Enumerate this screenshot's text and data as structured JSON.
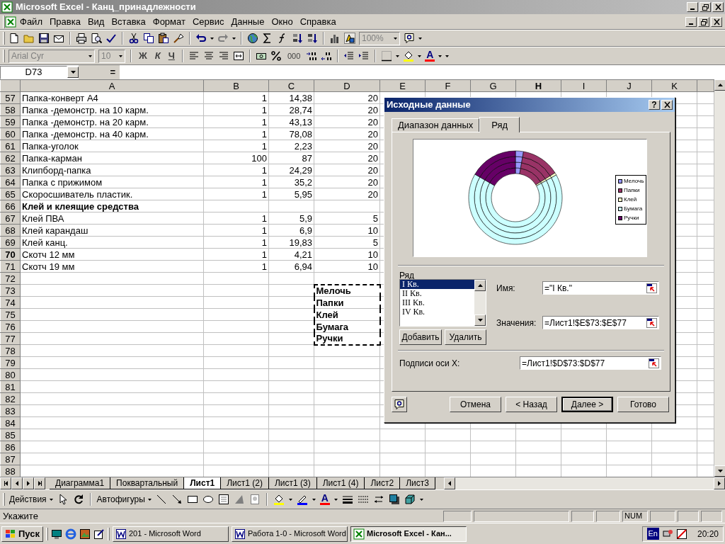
{
  "window": {
    "title": "Microsoft Excel - Канц_принадлежности"
  },
  "menu": [
    "Файл",
    "Правка",
    "Вид",
    "Вставка",
    "Формат",
    "Сервис",
    "Данные",
    "Окно",
    "Справка"
  ],
  "standard_toolbar": {
    "zoom": {
      "value": "100%",
      "disabled": true
    }
  },
  "formatting_toolbar": {
    "font": {
      "value": "Arial Cyr",
      "disabled": true
    },
    "size": {
      "value": "10",
      "disabled": true
    },
    "style_buttons": [
      "Ж",
      "К",
      "Ч"
    ],
    "thousands": "000",
    "font_color_glyph": "A"
  },
  "formula_bar": {
    "cell": "D73",
    "equals": "="
  },
  "sheet": {
    "columns": [
      {
        "label": "A",
        "selected": false
      },
      {
        "label": "B",
        "selected": false
      },
      {
        "label": "C",
        "selected": false
      },
      {
        "label": "D",
        "selected": false
      },
      {
        "label": "E",
        "selected": false
      },
      {
        "label": "F",
        "selected": false
      },
      {
        "label": "G",
        "selected": false
      },
      {
        "label": "H",
        "selected": true
      },
      {
        "label": "I",
        "selected": false
      },
      {
        "label": "J",
        "selected": false
      },
      {
        "label": "K",
        "selected": false
      }
    ],
    "rows": [
      {
        "header": "57",
        "selected": false,
        "bold": false,
        "marquee": false,
        "cells": {
          "A": "Папка-конверт А4",
          "B": "1",
          "C": "14,38",
          "D": "20"
        }
      },
      {
        "header": "58",
        "selected": false,
        "bold": false,
        "marquee": false,
        "cells": {
          "A": "Папка -демонстр. на 10 карм.",
          "B": "1",
          "C": "28,74",
          "D": "20"
        }
      },
      {
        "header": "59",
        "selected": false,
        "bold": false,
        "marquee": false,
        "cells": {
          "A": "Папка -демонстр. на 20 карм.",
          "B": "1",
          "C": "43,13",
          "D": "20"
        }
      },
      {
        "header": "60",
        "selected": false,
        "bold": false,
        "marquee": false,
        "cells": {
          "A": "Папка -демонстр. на 40 карм.",
          "B": "1",
          "C": "78,08",
          "D": "20"
        }
      },
      {
        "header": "61",
        "selected": false,
        "bold": false,
        "marquee": false,
        "cells": {
          "A": "Папка-уголок",
          "B": "1",
          "C": "2,23",
          "D": "20"
        }
      },
      {
        "header": "62",
        "selected": false,
        "bold": false,
        "marquee": false,
        "cells": {
          "A": "Папка-карман",
          "B": "100",
          "C": "87",
          "D": "20"
        }
      },
      {
        "header": "63",
        "selected": false,
        "bold": false,
        "marquee": false,
        "cells": {
          "A": "Клипборд-папка",
          "B": "1",
          "C": "24,29",
          "D": "20"
        }
      },
      {
        "header": "64",
        "selected": false,
        "bold": false,
        "marquee": false,
        "cells": {
          "A": "Папка с прижимом",
          "B": "1",
          "C": "35,2",
          "D": "20"
        }
      },
      {
        "header": "65",
        "selected": false,
        "bold": false,
        "marquee": false,
        "cells": {
          "A": "Скоросшиватель пластик.",
          "B": "1",
          "C": "5,95",
          "D": "20"
        }
      },
      {
        "header": "66",
        "selected": false,
        "bold": true,
        "marquee": false,
        "cells": {
          "A": "Клей и клеящие средства"
        }
      },
      {
        "header": "67",
        "selected": false,
        "bold": false,
        "marquee": false,
        "cells": {
          "A": "Клей ПВА",
          "B": "1",
          "C": "5,9",
          "D": "5"
        }
      },
      {
        "header": "68",
        "selected": false,
        "bold": false,
        "marquee": false,
        "cells": {
          "A": "Клей карандаш",
          "B": "1",
          "C": "6,9",
          "D": "10"
        }
      },
      {
        "header": "69",
        "selected": false,
        "bold": false,
        "marquee": false,
        "cells": {
          "A": "Клей канц.",
          "B": "1",
          "C": "19,83",
          "D": "5"
        }
      },
      {
        "header": "70",
        "selected": true,
        "bold": false,
        "marquee": false,
        "cells": {
          "A": "Скотч 12 мм",
          "B": "1",
          "C": "4,21",
          "D": "10"
        }
      },
      {
        "header": "71",
        "selected": false,
        "bold": false,
        "marquee": false,
        "cells": {
          "A": "Скотч 19 мм",
          "B": "1",
          "C": "6,94",
          "D": "10"
        }
      },
      {
        "header": "72",
        "selected": false
      },
      {
        "header": "73",
        "selected": false,
        "bold": true,
        "marquee": true,
        "cells": {
          "D": "Мелочь"
        }
      },
      {
        "header": "74",
        "selected": false,
        "bold": true,
        "marquee": true,
        "cells": {
          "D": "Папки"
        }
      },
      {
        "header": "75",
        "selected": false,
        "bold": true,
        "marquee": true,
        "cells": {
          "D": "Клей"
        }
      },
      {
        "header": "76",
        "selected": false,
        "bold": true,
        "marquee": true,
        "cells": {
          "D": "Бумага"
        }
      },
      {
        "header": "77",
        "selected": false,
        "bold": true,
        "marquee": true,
        "cells": {
          "D": "Ручки"
        }
      },
      {
        "header": "78",
        "selected": false
      },
      {
        "header": "79",
        "selected": false
      },
      {
        "header": "80",
        "selected": false
      },
      {
        "header": "81",
        "selected": false
      },
      {
        "header": "82",
        "selected": false
      },
      {
        "header": "83",
        "selected": false
      },
      {
        "header": "84",
        "selected": false
      },
      {
        "header": "85",
        "selected": false
      },
      {
        "header": "86",
        "selected": false
      },
      {
        "header": "87",
        "selected": false
      },
      {
        "header": "88",
        "selected": false
      }
    ]
  },
  "dialog": {
    "title": "Исходные данные",
    "help": "?",
    "tabs": [
      {
        "label": "Диапазон данных",
        "selected": false
      },
      {
        "label": "Ряд",
        "selected": true
      }
    ],
    "legend": [
      {
        "label": "Мелочь",
        "color": "#9999ff"
      },
      {
        "label": "Папки",
        "color": "#993366"
      },
      {
        "label": "Клей",
        "color": "#ffffcc"
      },
      {
        "label": "Бумага",
        "color": "#ccffff"
      },
      {
        "label": "Ручки",
        "color": "#660066"
      }
    ],
    "series_label": "Ряд",
    "series": [
      {
        "label": "I Кв.",
        "selected": true
      },
      {
        "label": "II Кв.",
        "selected": false
      },
      {
        "label": "III Кв.",
        "selected": false
      },
      {
        "label": "IV Кв.",
        "selected": false
      }
    ],
    "add": "Добавить",
    "remove": "Удалить",
    "fields": [
      {
        "label": "Имя:",
        "value": "=\"I Кв.\""
      },
      {
        "label": "Значения:",
        "value": "=Лист1!$E$73:$E$77"
      }
    ],
    "x_labels": {
      "label": "Подписи оси X:",
      "value": "=Лист1!$D$73:$D$77"
    },
    "buttons": [
      {
        "label": "Отмена",
        "default": false
      },
      {
        "label": "< Назад",
        "default": false
      },
      {
        "label": "Далее >",
        "default": true
      },
      {
        "label": "Готово",
        "default": false
      }
    ]
  },
  "sheet_tabs": [
    {
      "label": "Диаграмма1",
      "selected": false
    },
    {
      "label": "Поквартальный",
      "selected": false
    },
    {
      "label": "Лист1",
      "selected": true
    },
    {
      "label": "Лист1 (2)",
      "selected": false
    },
    {
      "label": "Лист1 (3)",
      "selected": false
    },
    {
      "label": "Лист1 (4)",
      "selected": false
    },
    {
      "label": "Лист2",
      "selected": false
    },
    {
      "label": "Лист3",
      "selected": false
    }
  ],
  "drawing_toolbar": {
    "actions": "Действия",
    "autoshapes": "Автофигуры",
    "font_color_glyph": "A"
  },
  "status_bar": {
    "text": "Укажите",
    "num": "NUM"
  },
  "taskbar": {
    "start": "Пуск",
    "tasks": [
      {
        "label": "201 - Microsoft Word",
        "selected": false
      },
      {
        "label": "Работа 1-0 - Microsoft Word",
        "selected": false
      },
      {
        "label": "Microsoft Excel - Кан...",
        "selected": true
      }
    ],
    "language": "En",
    "clock": "20:20"
  }
}
